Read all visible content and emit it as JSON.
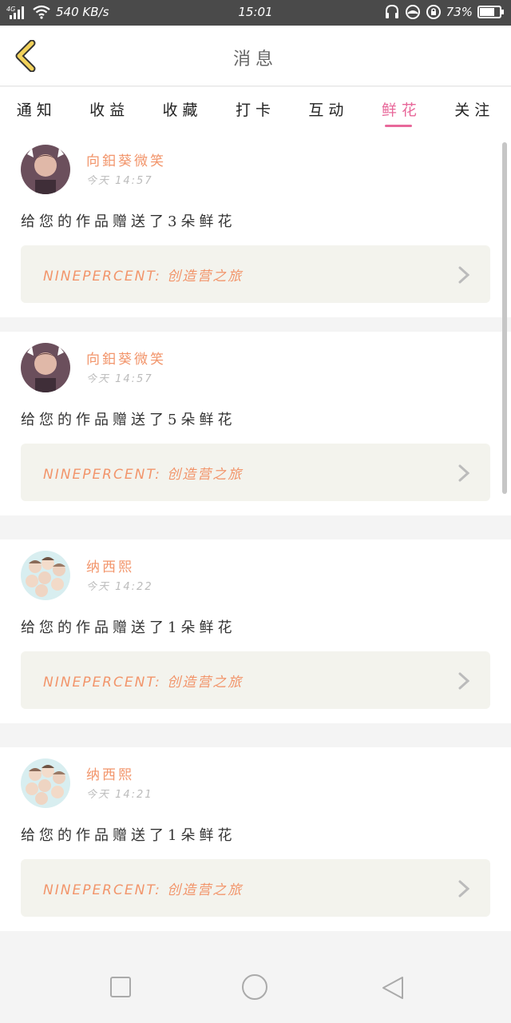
{
  "status_bar": {
    "network": "4G",
    "speed": "540 KB/s",
    "time": "15:01",
    "battery": "73%"
  },
  "header": {
    "title": "消息"
  },
  "tabs": [
    {
      "label": "通知",
      "active": false
    },
    {
      "label": "收益",
      "active": false
    },
    {
      "label": "收藏",
      "active": false
    },
    {
      "label": "打卡",
      "active": false
    },
    {
      "label": "互动",
      "active": false
    },
    {
      "label": "鲜花",
      "active": true
    },
    {
      "label": "关注",
      "active": false
    }
  ],
  "messages": [
    {
      "user": "向鈤葵微笑",
      "time": "今天 14:57",
      "text": "给您的作品赠送了3朵鲜花",
      "work": "NINEPERCENT: 创造营之旅"
    },
    {
      "user": "向鈤葵微笑",
      "time": "今天 14:57",
      "text": "给您的作品赠送了5朵鲜花",
      "work": "NINEPERCENT: 创造营之旅"
    },
    {
      "user": "纳西熙",
      "time": "今天 14:22",
      "text": "给您的作品赠送了1朵鲜花",
      "work": "NINEPERCENT: 创造营之旅"
    },
    {
      "user": "纳西熙",
      "time": "今天 14:21",
      "text": "给您的作品赠送了1朵鲜花",
      "work": "NINEPERCENT: 创造营之旅"
    }
  ],
  "colors": {
    "accent": "#e8689a",
    "username": "#f2956b",
    "link_bg": "#f3f3ed",
    "back_icon": "#f2c94c"
  },
  "icons": {
    "back": "chevron-left-icon",
    "chevron": "chevron-right-icon",
    "nav_recent": "square-icon",
    "nav_home": "circle-icon",
    "nav_back": "triangle-icon"
  }
}
